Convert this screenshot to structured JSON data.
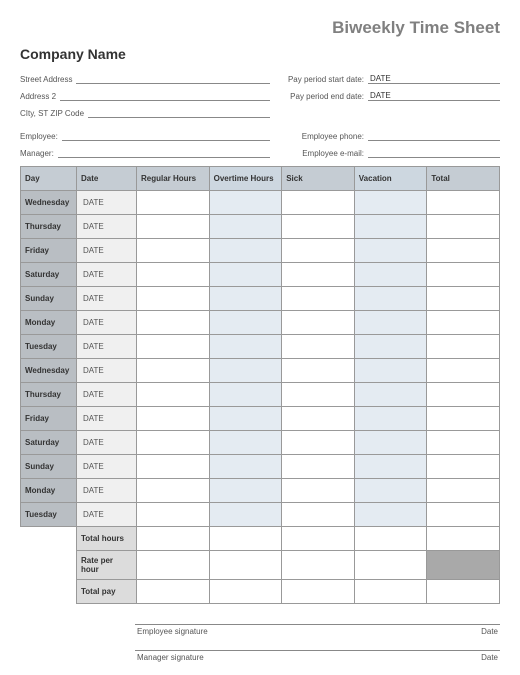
{
  "title": "Biweekly Time Sheet",
  "company": "Company Name",
  "address": {
    "street_label": "Street Address",
    "addr2_label": "Address 2",
    "cityzip_label": "CIty, ST  ZIP Code"
  },
  "period": {
    "start_label": "Pay period start date:",
    "start_value": "DATE",
    "end_label": "Pay period end date:",
    "end_value": "DATE"
  },
  "people": {
    "employee_label": "Employee:",
    "manager_label": "Manager:",
    "phone_label": "Employee phone:",
    "email_label": "Employee e-mail:"
  },
  "headers": {
    "day": "Day",
    "date": "Date",
    "regular": "Regular Hours",
    "overtime": "Overtime Hours",
    "sick": "Sick",
    "vacation": "Vacation",
    "total": "Total"
  },
  "rows": [
    {
      "day": "Wednesday",
      "date": "DATE"
    },
    {
      "day": "Thursday",
      "date": "DATE"
    },
    {
      "day": "Friday",
      "date": "DATE"
    },
    {
      "day": "Saturday",
      "date": "DATE"
    },
    {
      "day": "Sunday",
      "date": "DATE"
    },
    {
      "day": "Monday",
      "date": "DATE"
    },
    {
      "day": "Tuesday",
      "date": "DATE"
    },
    {
      "day": "Wednesday",
      "date": "DATE"
    },
    {
      "day": "Thursday",
      "date": "DATE"
    },
    {
      "day": "Friday",
      "date": "DATE"
    },
    {
      "day": "Saturday",
      "date": "DATE"
    },
    {
      "day": "Sunday",
      "date": "DATE"
    },
    {
      "day": "Monday",
      "date": "DATE"
    },
    {
      "day": "Tuesday",
      "date": "DATE"
    }
  ],
  "summary": {
    "total_hours": "Total hours",
    "rate": "Rate per hour",
    "total_pay": "Total pay"
  },
  "signatures": {
    "employee": "Employee signature",
    "manager": "Manager signature",
    "date": "Date"
  }
}
